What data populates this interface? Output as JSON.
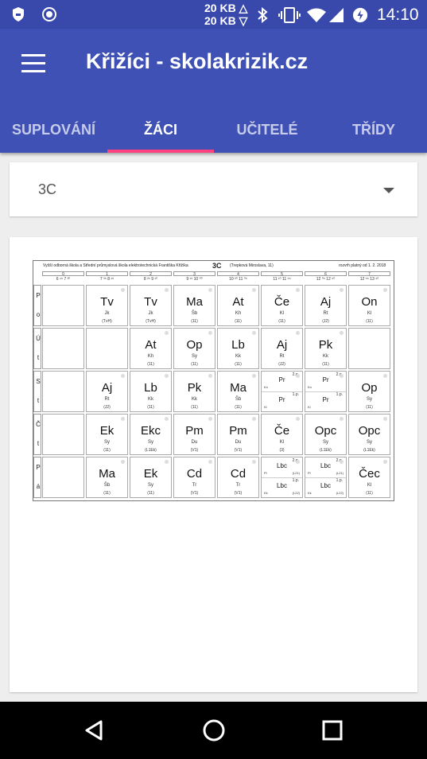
{
  "status_bar": {
    "net_up": "20 KB △",
    "net_down": "20 KB ▽",
    "time": "14:10",
    "icons": [
      "shield-icon",
      "record-icon",
      "bluetooth-icon",
      "vibrate-icon",
      "wifi-icon",
      "signal-icon",
      "battery-saver-icon"
    ]
  },
  "app_bar": {
    "title": "Křižíci - skolakrizik.cz",
    "tabs": [
      "SUPLOVÁNÍ",
      "ŽÁCI",
      "UČITELÉ",
      "TŘÍDY"
    ],
    "active_tab": 1
  },
  "class_select": {
    "value": "3C"
  },
  "timetable": {
    "header": {
      "school": "Vyšší odborná škola a Střední průmyslová škola elektrotechnická Františka Křižíka",
      "class": "3C",
      "teacher": "(Trepková Miroslava, 11)",
      "valid": "rozvrh platný od 1. 2. 2018"
    },
    "periods": [
      {
        "n": "0",
        "t": "6 ⁴⁵ 7 ³⁰"
      },
      {
        "n": "1",
        "t": "7 ³⁵ 8 ¹⁵"
      },
      {
        "n": "2",
        "t": "8 ²⁵ 9 ¹⁰"
      },
      {
        "n": "3",
        "t": "9 ¹⁵ 10 ⁰⁰"
      },
      {
        "n": "4",
        "t": "10 ²⁰ 11 ⁰⁵"
      },
      {
        "n": "5",
        "t": "11 ¹⁰ 11 ⁵⁵"
      },
      {
        "n": "6",
        "t": "12 ⁰⁵ 12 ⁵⁰"
      },
      {
        "n": "7",
        "t": "12 ⁵⁵ 13 ⁴⁰"
      }
    ],
    "days": [
      {
        "letters": [
          "P",
          "o"
        ],
        "cells": [
          {
            "type": "empty"
          },
          {
            "type": "single",
            "s": "Tv",
            "t": "Jk",
            "r": "(TvH)"
          },
          {
            "type": "single",
            "s": "Tv",
            "t": "Jk",
            "r": "(TvH)"
          },
          {
            "type": "single",
            "s": "Ma",
            "t": "Šb",
            "r": "(11)"
          },
          {
            "type": "single",
            "s": "At",
            "t": "Kh",
            "r": "(11)"
          },
          {
            "type": "single",
            "s": "Če",
            "t": "Kl",
            "r": "(11)"
          },
          {
            "type": "single",
            "s": "Aj",
            "t": "Rt",
            "r": "(J2)"
          },
          {
            "type": "single",
            "s": "On",
            "t": "Kl",
            "r": "(11)"
          }
        ]
      },
      {
        "letters": [
          "Ú",
          "t"
        ],
        "cells": [
          {
            "type": "empty"
          },
          {
            "type": "empty"
          },
          {
            "type": "single",
            "s": "At",
            "t": "Kh",
            "r": "(11)"
          },
          {
            "type": "single",
            "s": "Op",
            "t": "Sy",
            "r": "(11)"
          },
          {
            "type": "single",
            "s": "Lb",
            "t": "Kk",
            "r": "(11)"
          },
          {
            "type": "single",
            "s": "Aj",
            "t": "Rt",
            "r": "(J2)"
          },
          {
            "type": "single",
            "s": "Pk",
            "t": "Kk",
            "r": "(11)"
          },
          {
            "type": "empty"
          }
        ]
      },
      {
        "letters": [
          "S",
          "t"
        ],
        "cells": [
          {
            "type": "empty"
          },
          {
            "type": "single",
            "s": "Aj",
            "t": "Rt",
            "r": "(J2)"
          },
          {
            "type": "single",
            "s": "Lb",
            "t": "Kk",
            "r": "(11)"
          },
          {
            "type": "single",
            "s": "Pk",
            "t": "Kk",
            "r": "(11)"
          },
          {
            "type": "single",
            "s": "Ma",
            "t": "Šb",
            "r": "(11)"
          },
          {
            "type": "split",
            "top": {
              "g": "2.p.",
              "s": "Pr",
              "t": "Kn",
              "r": ""
            },
            "bot": {
              "g": "1.p.",
              "s": "Pr",
              "t": "Kl",
              "r": ""
            }
          },
          {
            "type": "split",
            "top": {
              "g": "2.p.",
              "s": "Pr",
              "t": "Kn",
              "r": ""
            },
            "bot": {
              "g": "1.p.",
              "s": "Pr",
              "t": "Kl",
              "r": ""
            }
          },
          {
            "type": "single",
            "s": "Op",
            "t": "Sy",
            "r": "(11)"
          }
        ]
      },
      {
        "letters": [
          "Č",
          "t"
        ],
        "cells": [
          {
            "type": "empty"
          },
          {
            "type": "single",
            "s": "Ek",
            "t": "Sy",
            "r": "(11)"
          },
          {
            "type": "single",
            "s": "Ekc",
            "t": "Sy",
            "r": "(L1Ek)"
          },
          {
            "type": "single",
            "s": "Pm",
            "t": "Du",
            "r": "(V1)"
          },
          {
            "type": "single",
            "s": "Pm",
            "t": "Du",
            "r": "(V1)"
          },
          {
            "type": "single",
            "s": "Če",
            "t": "Kl",
            "r": "(3)"
          },
          {
            "type": "single",
            "s": "Opc",
            "t": "Sy",
            "r": "(L1Ek)"
          },
          {
            "type": "single",
            "s": "Opc",
            "t": "Sy",
            "r": "(L1Ek)"
          }
        ]
      },
      {
        "letters": [
          "P",
          "á"
        ],
        "cells": [
          {
            "type": "empty"
          },
          {
            "type": "single",
            "s": "Ma",
            "t": "Šb",
            "r": "(11)"
          },
          {
            "type": "single",
            "s": "Ek",
            "t": "Sy",
            "r": "(11)"
          },
          {
            "type": "single",
            "s": "Cd",
            "t": "Tr",
            "r": "(V1)"
          },
          {
            "type": "single",
            "s": "Cd",
            "t": "Tr",
            "r": "(V1)"
          },
          {
            "type": "split",
            "top": {
              "g": "2.p.",
              "s": "Lbc",
              "t": "Pl",
              "r": "(L21)"
            },
            "bot": {
              "g": "1.p.",
              "s": "Lbc",
              "t": "Kk",
              "r": "(L22)"
            }
          },
          {
            "type": "split",
            "top": {
              "g": "2.p.",
              "s": "Lbc",
              "t": "Pl",
              "r": "(L21)"
            },
            "bot": {
              "g": "1.p.",
              "s": "Lbc",
              "t": "Kk",
              "r": "(L22)"
            }
          },
          {
            "type": "single",
            "s": "Čec",
            "t": "Kl",
            "r": "(11)"
          }
        ]
      }
    ]
  },
  "nav_bar": {
    "buttons": [
      "back-icon",
      "home-icon",
      "recents-icon"
    ]
  }
}
